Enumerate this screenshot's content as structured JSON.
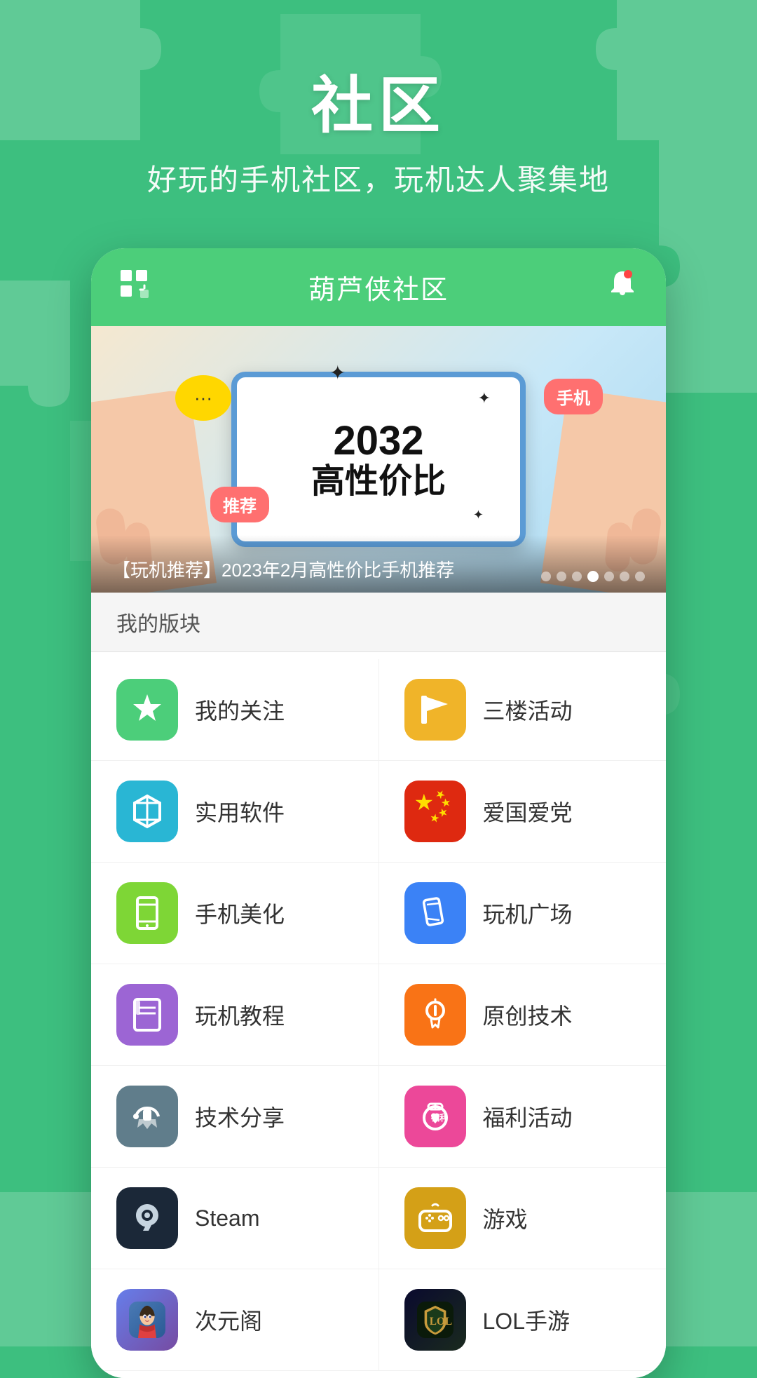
{
  "header": {
    "title": "社区",
    "subtitle": "好玩的手机社区，玩机达人聚集地"
  },
  "app_header": {
    "title": "葫芦侠社区",
    "grid_icon": "grid-icon",
    "bell_icon": "bell-icon"
  },
  "banner": {
    "year": "2032",
    "text": "高性价比",
    "badge_recommend": "推荐",
    "badge_phone": "手机",
    "caption": "【玩机推荐】2023年2月高性价比手机推荐",
    "dots": [
      1,
      2,
      3,
      4,
      5,
      6,
      7
    ],
    "active_dot": 4
  },
  "sections": {
    "my_blocks": "我的版块"
  },
  "menu_items": [
    {
      "id": "my-follow",
      "label": "我的关注",
      "icon_color": "green",
      "icon_type": "star"
    },
    {
      "id": "3f-activity",
      "label": "三楼活动",
      "icon_color": "yellow",
      "icon_type": "flag"
    },
    {
      "id": "useful-software",
      "label": "实用软件",
      "icon_color": "cyan",
      "icon_type": "box"
    },
    {
      "id": "patriot",
      "label": "爱国爱党",
      "icon_color": "red",
      "icon_type": "flag-cn"
    },
    {
      "id": "phone-beauty",
      "label": "手机美化",
      "icon_color": "light-green",
      "icon_type": "book"
    },
    {
      "id": "play-phone-square",
      "label": "玩机广场",
      "icon_color": "blue",
      "icon_type": "phone"
    },
    {
      "id": "play-tutorial",
      "label": "玩机教程",
      "icon_color": "purple",
      "icon_type": "bookmark"
    },
    {
      "id": "original-tech",
      "label": "原创技术",
      "icon_color": "orange",
      "icon_type": "bulb"
    },
    {
      "id": "tech-share",
      "label": "技术分享",
      "icon_color": "gray-blue",
      "icon_type": "wrench"
    },
    {
      "id": "welfare",
      "label": "福利活动",
      "icon_color": "pink",
      "icon_type": "gift"
    },
    {
      "id": "steam",
      "label": "Steam",
      "icon_color": "dark-navy",
      "icon_type": "steam"
    },
    {
      "id": "games",
      "label": "游戏",
      "icon_color": "gold",
      "icon_type": "game"
    },
    {
      "id": "anime",
      "label": "次元阁",
      "icon_color": "anime",
      "icon_type": "anime"
    },
    {
      "id": "lol",
      "label": "LOL手游",
      "icon_color": "lol",
      "icon_type": "lol"
    }
  ]
}
